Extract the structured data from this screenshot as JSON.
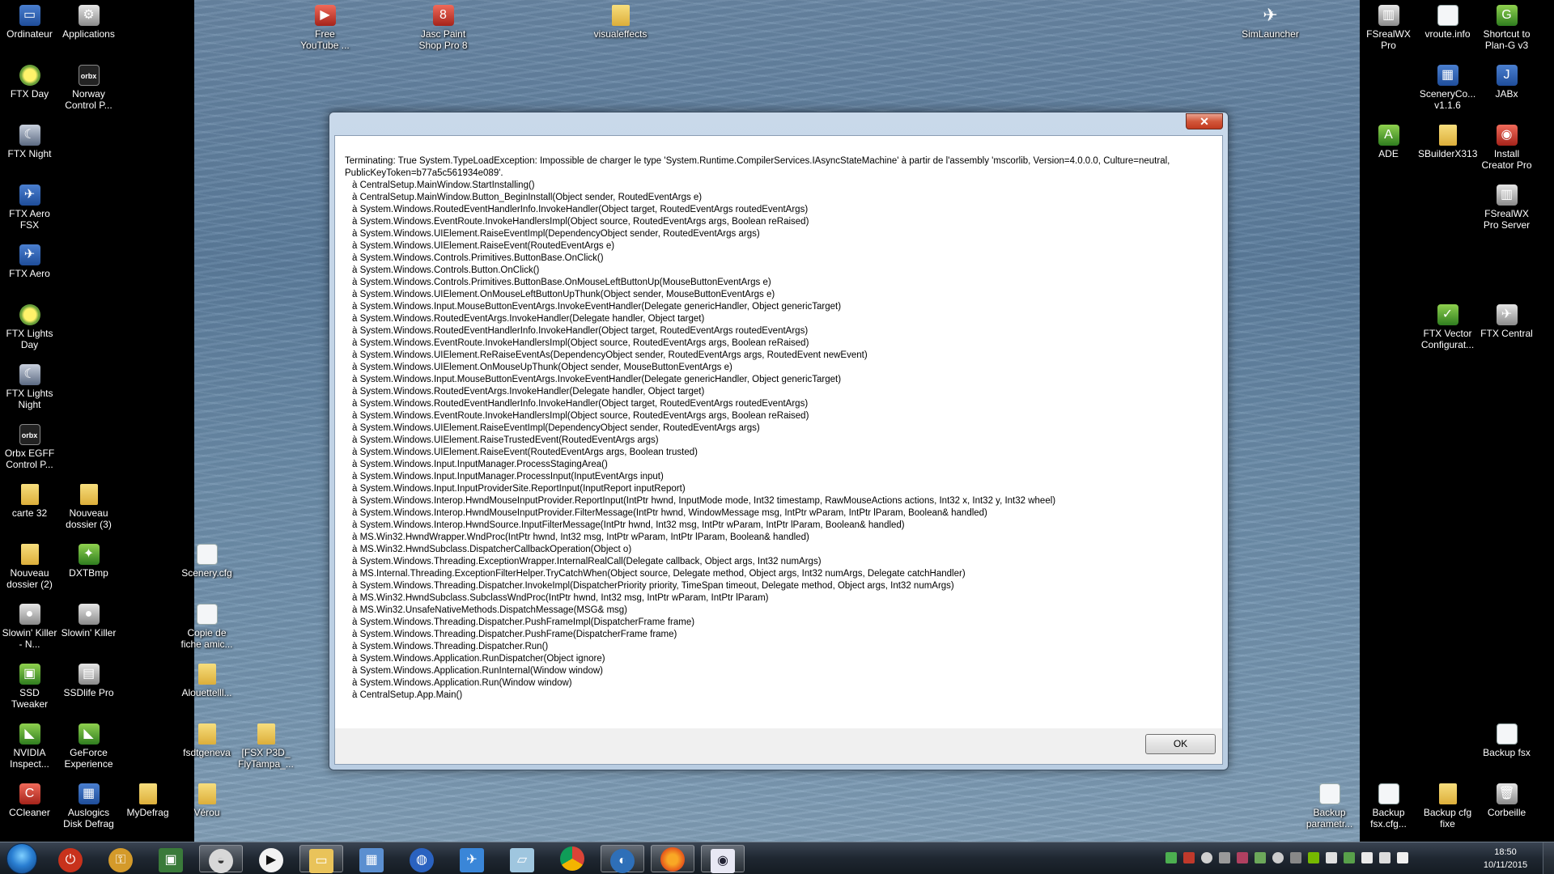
{
  "desktop_icons": {
    "computer": "Ordinateur",
    "applications": "Applications",
    "ftx_day": "FTX Day",
    "norway": "Norway Control P...",
    "ftx_night": "FTX Night",
    "ftx_aero_fsx": "FTX Aero FSX",
    "ftx_aero": "FTX Aero",
    "ftx_lights_day": "FTX Lights Day",
    "ftx_lights_night": "FTX Lights Night",
    "orbx_egff": "Orbx EGFF Control P...",
    "carte32": "carte 32",
    "nouveau_dossier_3": "Nouveau dossier (3)",
    "nouveau_dossier_2": "Nouveau dossier (2)",
    "dxtbmp": "DXTBmp",
    "slowin_killer_n": "Slowin' Killer - N...",
    "slowin_killer": "Slowin' Killer",
    "ssd_tweaker": "SSD Tweaker",
    "ssdlife": "SSDlife Pro",
    "nvidia": "NVIDIA Inspect...",
    "geforce": "GeForce Experience",
    "ccleaner": "CCleaner",
    "auslogics": "Auslogics Disk Defrag",
    "mydefrag": "MyDefrag",
    "scenery_cfg": "Scenery.cfg",
    "copie_fiche": "Copie de fiche amic...",
    "alouette": "Alouettelll...",
    "fsdtgeneva": "fsdtgeneva",
    "fsx_p3d": "[FSX P3D_ FlyTampa_...",
    "verou": "Vérou",
    "free_youtube": "Free YouTube ...",
    "jasc": "Jasc Paint Shop Pro 8",
    "visualeffects": "visualeffects",
    "simlauncher": "SimLauncher",
    "fsrealwx_pro": "FSrealWX Pro",
    "vroute": "vroute.info",
    "shortcut_plan_g": "Shortcut to Plan-G v3",
    "sceneryco": "SceneryCo... v1.1.6",
    "jabx": "JABx",
    "ade": "ADE",
    "sbuilder": "SBuilderX313",
    "install_creator": "Install Creator Pro",
    "fsrealwx_server": "FSrealWX Pro Server",
    "ftx_vector": "FTX Vector Configurat...",
    "ftx_central": "FTX Central",
    "backup_fsx": "Backup fsx",
    "backup_param": "Backup parametr...",
    "backup_fsx_cfg": "Backup fsx.cfg...",
    "backup_cfg_fixe": "Backup cfg fixe",
    "corbeille": "Corbeille"
  },
  "dialog": {
    "close_label": "✕",
    "ok_label": "OK",
    "message_head": "Terminating: True System.TypeLoadException: Impossible de charger le type 'System.Runtime.CompilerServices.IAsyncStateMachine' à partir de l'assembly 'mscorlib, Version=4.0.0.0, Culture=neutral,",
    "message_head2": "PublicKeyToken=b77a5c561934e089'.",
    "frames": [
      "à CentralSetup.MainWindow.StartInstalling()",
      "à CentralSetup.MainWindow.Button_BeginInstall(Object sender, RoutedEventArgs e)",
      "à System.Windows.RoutedEventHandlerInfo.InvokeHandler(Object target, RoutedEventArgs routedEventArgs)",
      "à System.Windows.EventRoute.InvokeHandlersImpl(Object source, RoutedEventArgs args, Boolean reRaised)",
      "à System.Windows.UIElement.RaiseEventImpl(DependencyObject sender, RoutedEventArgs args)",
      "à System.Windows.UIElement.RaiseEvent(RoutedEventArgs e)",
      "à System.Windows.Controls.Primitives.ButtonBase.OnClick()",
      "à System.Windows.Controls.Button.OnClick()",
      "à System.Windows.Controls.Primitives.ButtonBase.OnMouseLeftButtonUp(MouseButtonEventArgs e)",
      "à System.Windows.UIElement.OnMouseLeftButtonUpThunk(Object sender, MouseButtonEventArgs e)",
      "à System.Windows.Input.MouseButtonEventArgs.InvokeEventHandler(Delegate genericHandler, Object genericTarget)",
      "à System.Windows.RoutedEventArgs.InvokeHandler(Delegate handler, Object target)",
      "à System.Windows.RoutedEventHandlerInfo.InvokeHandler(Object target, RoutedEventArgs routedEventArgs)",
      "à System.Windows.EventRoute.InvokeHandlersImpl(Object source, RoutedEventArgs args, Boolean reRaised)",
      "à System.Windows.UIElement.ReRaiseEventAs(DependencyObject sender, RoutedEventArgs args, RoutedEvent newEvent)",
      "à System.Windows.UIElement.OnMouseUpThunk(Object sender, MouseButtonEventArgs e)",
      "à System.Windows.Input.MouseButtonEventArgs.InvokeEventHandler(Delegate genericHandler, Object genericTarget)",
      "à System.Windows.RoutedEventArgs.InvokeHandler(Delegate handler, Object target)",
      "à System.Windows.RoutedEventHandlerInfo.InvokeHandler(Object target, RoutedEventArgs routedEventArgs)",
      "à System.Windows.EventRoute.InvokeHandlersImpl(Object source, RoutedEventArgs args, Boolean reRaised)",
      "à System.Windows.UIElement.RaiseEventImpl(DependencyObject sender, RoutedEventArgs args)",
      "à System.Windows.UIElement.RaiseTrustedEvent(RoutedEventArgs args)",
      "à System.Windows.UIElement.RaiseEvent(RoutedEventArgs args, Boolean trusted)",
      "à System.Windows.Input.InputManager.ProcessStagingArea()",
      "à System.Windows.Input.InputManager.ProcessInput(InputEventArgs input)",
      "à System.Windows.Input.InputProviderSite.ReportInput(InputReport inputReport)",
      "à System.Windows.Interop.HwndMouseInputProvider.ReportInput(IntPtr hwnd, InputMode mode, Int32 timestamp, RawMouseActions actions, Int32 x, Int32 y, Int32 wheel)",
      "à System.Windows.Interop.HwndMouseInputProvider.FilterMessage(IntPtr hwnd, WindowMessage msg, IntPtr wParam, IntPtr lParam, Boolean& handled)",
      "à System.Windows.Interop.HwndSource.InputFilterMessage(IntPtr hwnd, Int32 msg, IntPtr wParam, IntPtr lParam, Boolean& handled)",
      "à MS.Win32.HwndWrapper.WndProc(IntPtr hwnd, Int32 msg, IntPtr wParam, IntPtr lParam, Boolean& handled)",
      "à MS.Win32.HwndSubclass.DispatcherCallbackOperation(Object o)",
      "à System.Windows.Threading.ExceptionWrapper.InternalRealCall(Delegate callback, Object args, Int32 numArgs)",
      "à MS.Internal.Threading.ExceptionFilterHelper.TryCatchWhen(Object source, Delegate method, Object args, Int32 numArgs, Delegate catchHandler)",
      "à System.Windows.Threading.Dispatcher.InvokeImpl(DispatcherPriority priority, TimeSpan timeout, Delegate method, Object args, Int32 numArgs)",
      "à MS.Win32.HwndSubclass.SubclassWndProc(IntPtr hwnd, Int32 msg, IntPtr wParam, IntPtr lParam)",
      "à MS.Win32.UnsafeNativeMethods.DispatchMessage(MSG& msg)",
      "à System.Windows.Threading.Dispatcher.PushFrameImpl(DispatcherFrame frame)",
      "à System.Windows.Threading.Dispatcher.PushFrame(DispatcherFrame frame)",
      "à System.Windows.Threading.Dispatcher.Run()",
      "à System.Windows.Application.RunDispatcher(Object ignore)",
      "à System.Windows.Application.RunInternal(Window window)",
      "à System.Windows.Application.Run(Window window)",
      "à CentralSetup.App.Main()"
    ]
  },
  "taskbar": {
    "time": "18:50",
    "date": "10/11/2015"
  }
}
